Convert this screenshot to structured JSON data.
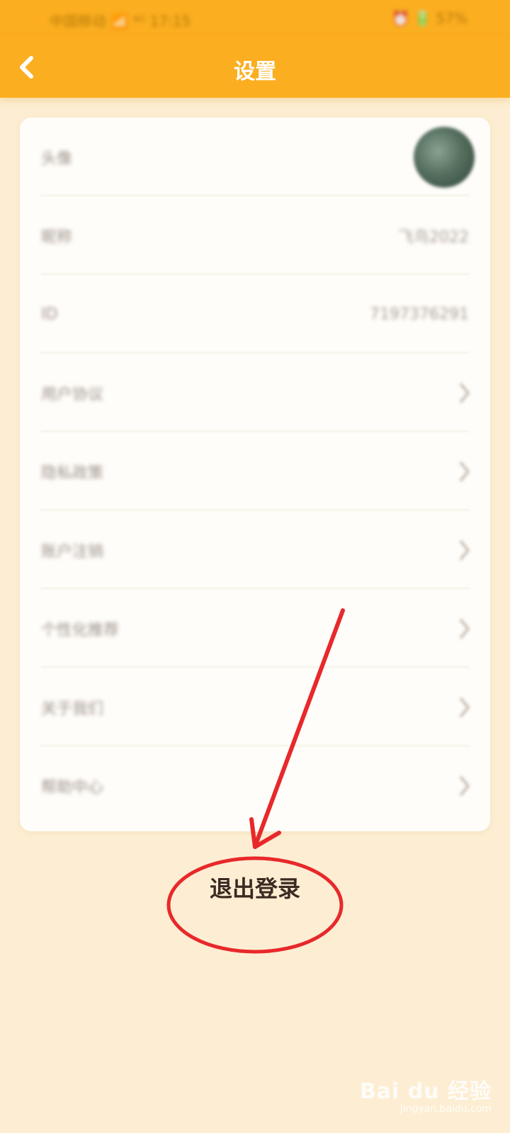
{
  "status_bar": {
    "left": "中国移动 📶 ⁴ᴳ 17:15",
    "right": "⏰ 🔋 57%"
  },
  "header": {
    "title": "设置"
  },
  "settings": {
    "rows": [
      {
        "label": "头像"
      },
      {
        "label": "昵称",
        "value": "飞鸟2022"
      },
      {
        "label": "ID",
        "value": "7197376291"
      },
      {
        "label": "用户协议"
      },
      {
        "label": "隐私政策"
      },
      {
        "label": "账户注销"
      },
      {
        "label": "个性化推荐"
      },
      {
        "label": "关于我们"
      },
      {
        "label": "帮助中心"
      }
    ]
  },
  "logout": {
    "label": "退出登录"
  },
  "watermark": {
    "brand": "Bai du 经验",
    "url": "jingyan.baidu.com"
  },
  "colors": {
    "header": "#fbae20",
    "background": "#fdeed3",
    "annotation": "#e8282a"
  }
}
